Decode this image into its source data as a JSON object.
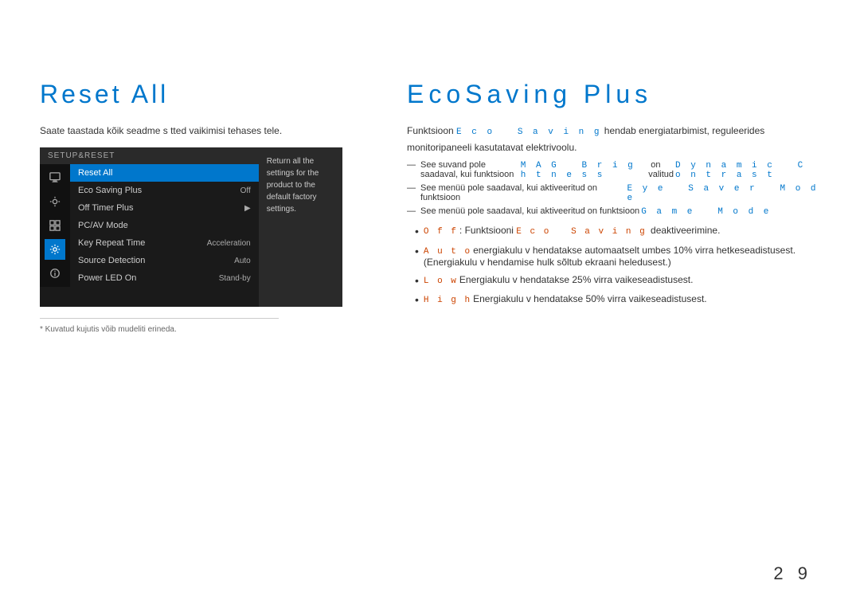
{
  "left": {
    "title": "Reset All",
    "description": "Saate taastada kõik seadme s tted vaikimisi tehases tele.",
    "osd": {
      "header": "SETUP&RESET",
      "items": [
        {
          "label": "Reset All",
          "value": "",
          "arrow": false,
          "selected": true
        },
        {
          "label": "Eco Saving Plus",
          "value": "Off",
          "arrow": false,
          "selected": false
        },
        {
          "label": "Off Timer Plus",
          "value": "",
          "arrow": true,
          "selected": false
        },
        {
          "label": "PC/AV Mode",
          "value": "",
          "arrow": false,
          "selected": false
        },
        {
          "label": "Key Repeat Time",
          "value": "Acceleration",
          "arrow": false,
          "selected": false
        },
        {
          "label": "Source Detection",
          "value": "Auto",
          "arrow": false,
          "selected": false
        },
        {
          "label": "Power LED On",
          "value": "Stand-by",
          "arrow": false,
          "selected": false
        }
      ],
      "tooltip": "Return all the settings for the product to the default factory settings."
    },
    "footnote": "* Kuvatud kujutis võib mudeliti erineda."
  },
  "right": {
    "title": "EcoSaving Plus",
    "intro": "Funktsioon Eco Saving hendab energiatarbimist, reguleerides monitoripaneeli kasutatavat elektrivoolu.",
    "notes": [
      "See suvand pole saadaval, kui funktsioon MAG Brightness on valitud Dynamic Contrast",
      "See menüü pole saadaval, kui aktiveeritud on funktsioon Eye Saver Mode",
      "See menüü pole saadaval, kui aktiveeritud on funktsioon Game Mode"
    ],
    "bullets": [
      {
        "label": "Off",
        "prefix": "Off: Funktsiooni Eco Saving deaktiveerimine."
      },
      {
        "label": "Auto",
        "text": "energiakulu v hendatakse automaatselt umbes 10% virra hetkeseadistusest. (Energiakulu v hendamise hulk sõltub ekraani heledusest.)"
      },
      {
        "label": "Low",
        "text": "Energiakulu v hendatakse 25% virra vaikeseadistusest."
      },
      {
        "label": "High",
        "text": "Energiakulu v hendatakse 50% virra vaikeseadistusest."
      }
    ]
  },
  "page_number": "2 9"
}
